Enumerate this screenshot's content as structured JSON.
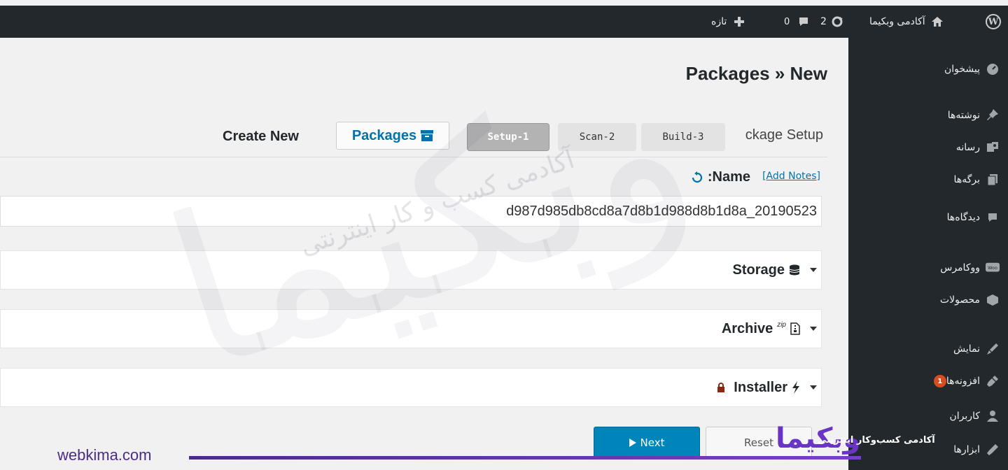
{
  "adminbar": {
    "site_name": "آکادمی وبکیما",
    "updates_count": "2",
    "comments_count": "0",
    "new_label": "تازه"
  },
  "sidebar": {
    "items": [
      {
        "label": "پیشخوان",
        "icon": "dashboard-icon"
      },
      {
        "label": "نوشته‌ها",
        "icon": "pin-icon"
      },
      {
        "label": "رسانه",
        "icon": "media-icon"
      },
      {
        "label": "برگه‌ها",
        "icon": "pages-icon"
      },
      {
        "label": "دیدگاه‌ها",
        "icon": "comments-icon"
      },
      {
        "label": "ووکامرس",
        "icon": "woo-icon"
      },
      {
        "label": "محصولات",
        "icon": "products-icon"
      },
      {
        "label": "نمایش",
        "icon": "appearance-icon"
      },
      {
        "label": "افزونه‌ها",
        "icon": "plugins-icon",
        "badge": "1"
      },
      {
        "label": "کاربران",
        "icon": "users-icon"
      },
      {
        "label": "ابزارها",
        "icon": "tools-icon"
      }
    ]
  },
  "main": {
    "title": "Packages » New",
    "step_heading": "ckage Setup",
    "steps": [
      "Setup-1",
      "Scan-2",
      "Build-3"
    ],
    "packages_button": "Packages",
    "create_new": "Create New",
    "name_label": ":Name",
    "add_notes": "[Add Notes]",
    "name_value": "d987d985db8cd8a7d8b1d988d8b1d8a_20190523",
    "panels": [
      "Storage",
      "Archive",
      "Installer"
    ],
    "archive_sup": "zip",
    "next_button": "Next",
    "reset_button": "Reset"
  },
  "watermark": {
    "brand": "وبکیما",
    "subtitle": "آکادمی کسب و کار اینترنتی"
  },
  "footer": {
    "url": "webkima.com",
    "logo": "وبکیما",
    "tagline": "آکادمی کسب‌وکار اینترنتی"
  },
  "colors": {
    "adminbar_bg": "#23282d",
    "link": "#0073aa",
    "primary_button": "#0085ba",
    "badge": "#d54e21",
    "brand_purple": "#4a2c87"
  }
}
